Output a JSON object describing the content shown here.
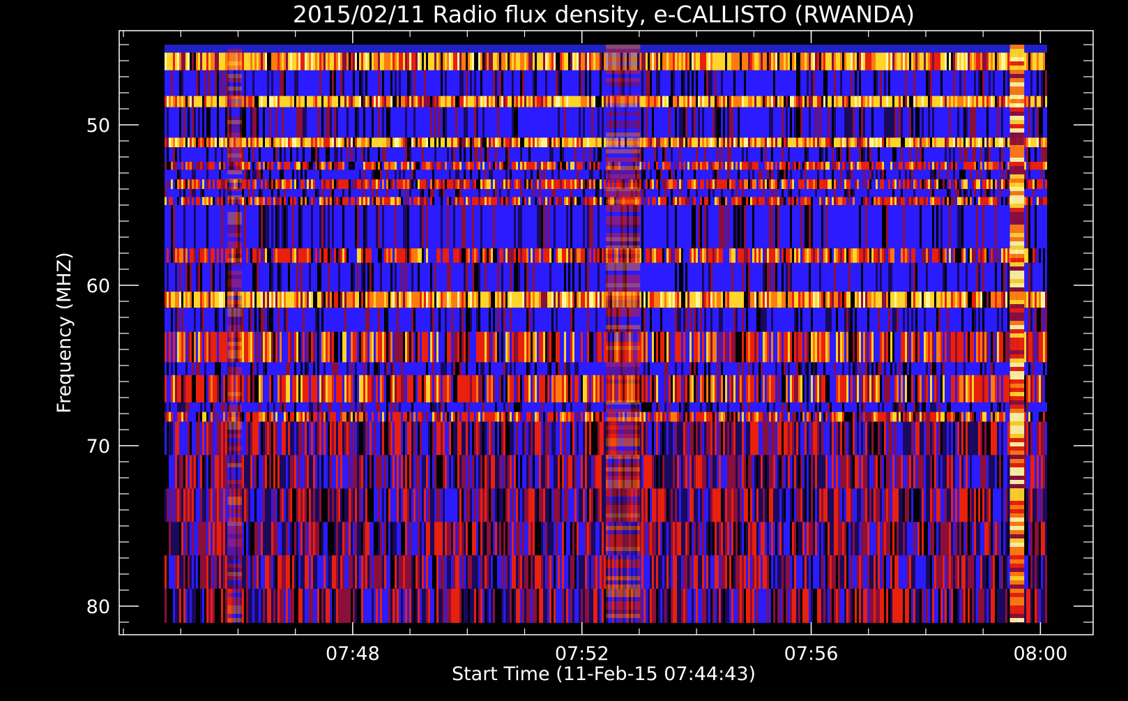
{
  "chart_data": {
    "type": "heatmap",
    "title": "2015/02/11  Radio flux density, e-CALLISTO (RWANDA)",
    "xlabel": "Start Time (11-Feb-15 07:44:43)",
    "ylabel": "Frequency (MHZ)",
    "x_data_range": [
      "07:44:43",
      "08:00:07"
    ],
    "y_data_range": [
      45,
      81
    ],
    "y_inverted": true,
    "x_ticks": [
      {
        "label": "07:48",
        "minutes": 3.283
      },
      {
        "label": "07:52",
        "minutes": 7.283
      },
      {
        "label": "07:56",
        "minutes": 11.283
      },
      {
        "label": "08:00",
        "minutes": 15.283
      }
    ],
    "y_ticks": [
      {
        "label": "50",
        "value": 50
      },
      {
        "label": "60",
        "value": 60
      },
      {
        "label": "70",
        "value": 70
      },
      {
        "label": "80",
        "value": 80
      }
    ],
    "colormap": [
      "#000000",
      "#1a0a5e",
      "#2b1bff",
      "#8a0f3a",
      "#e8200c",
      "#ff7b10",
      "#ffd52a",
      "#fff6a0"
    ],
    "horizontal_bands": [
      {
        "freq_from": 45.5,
        "freq_to": 46.6,
        "level": "bright"
      },
      {
        "freq_from": 46.6,
        "freq_to": 48.2,
        "level": "quiet"
      },
      {
        "freq_from": 48.2,
        "freq_to": 48.9,
        "level": "bright"
      },
      {
        "freq_from": 48.9,
        "freq_to": 50.8,
        "level": "quiet"
      },
      {
        "freq_from": 50.8,
        "freq_to": 51.4,
        "level": "bright"
      },
      {
        "freq_from": 51.4,
        "freq_to": 52.3,
        "level": "quiet"
      },
      {
        "freq_from": 52.3,
        "freq_to": 52.8,
        "level": "medium"
      },
      {
        "freq_from": 52.8,
        "freq_to": 53.4,
        "level": "quiet"
      },
      {
        "freq_from": 53.4,
        "freq_to": 54.0,
        "level": "medium"
      },
      {
        "freq_from": 54.0,
        "freq_to": 54.5,
        "level": "quiet"
      },
      {
        "freq_from": 54.5,
        "freq_to": 55.0,
        "level": "medium"
      },
      {
        "freq_from": 55.0,
        "freq_to": 57.7,
        "level": "quiet"
      },
      {
        "freq_from": 57.7,
        "freq_to": 58.6,
        "level": "medium"
      },
      {
        "freq_from": 58.6,
        "freq_to": 60.4,
        "level": "quiet"
      },
      {
        "freq_from": 60.4,
        "freq_to": 61.4,
        "level": "bright"
      },
      {
        "freq_from": 61.4,
        "freq_to": 62.9,
        "level": "quiet"
      },
      {
        "freq_from": 62.9,
        "freq_to": 64.8,
        "level": "medium"
      },
      {
        "freq_from": 64.8,
        "freq_to": 65.6,
        "level": "quiet"
      },
      {
        "freq_from": 65.6,
        "freq_to": 67.3,
        "level": "medium"
      },
      {
        "freq_from": 67.3,
        "freq_to": 67.9,
        "level": "quiet"
      },
      {
        "freq_from": 67.9,
        "freq_to": 68.5,
        "level": "medium"
      },
      {
        "freq_from": 68.5,
        "freq_to": 81.0,
        "level": "diffuse"
      }
    ],
    "vertical_features": [
      {
        "minutes_from": 14.75,
        "minutes_to": 15.0,
        "level": "bright"
      },
      {
        "minutes_from": 1.1,
        "minutes_to": 1.35,
        "level": "medium"
      },
      {
        "minutes_from": 7.7,
        "minutes_to": 8.3,
        "level": "medium"
      }
    ],
    "grid": false,
    "legend": "none"
  }
}
